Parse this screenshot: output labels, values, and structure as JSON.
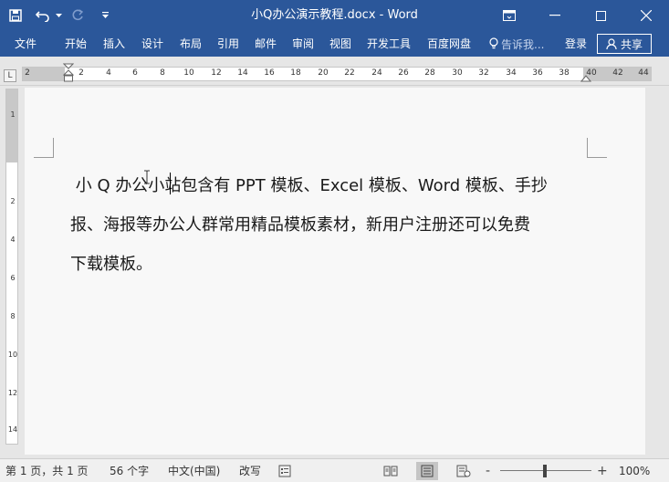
{
  "window": {
    "title": "小Q办公演示教程.docx - Word",
    "qat": {
      "save_icon": "save-icon",
      "undo_icon": "undo-icon",
      "redo_icon": "redo-icon",
      "customize_icon": "chevron-down-icon"
    },
    "controls": {
      "ribbon_display_icon": "ribbon-display-icon",
      "minimize_icon": "minimize-icon",
      "maximize_icon": "maximize-icon",
      "close_icon": "close-icon"
    }
  },
  "ribbon": {
    "tabs": [
      "文件",
      "开始",
      "插入",
      "设计",
      "布局",
      "引用",
      "邮件",
      "审阅",
      "视图",
      "开发工具",
      "百度网盘"
    ],
    "tell_me": "告诉我...",
    "login": "登录",
    "share": "共享"
  },
  "ruler": {
    "corner": "L",
    "h_labels": [
      "2",
      "2",
      "4",
      "6",
      "8",
      "10",
      "12",
      "14",
      "16",
      "18",
      "20",
      "22",
      "24",
      "26",
      "28",
      "30",
      "32",
      "34",
      "36",
      "38",
      "40",
      "42",
      "44"
    ],
    "v_labels": [
      "1",
      "2",
      "4",
      "6",
      "8",
      "10",
      "12",
      "14"
    ]
  },
  "document": {
    "lines": [
      " 小 Q 办公小站包含有 PPT 模板、Excel 模板、Word 模板、手抄",
      "报、海报等办公人群常用精品模板素材，新用户注册还可以免费",
      "下载模板。"
    ]
  },
  "status": {
    "page": "第 1 页，共 1 页",
    "words": "56 个字",
    "language": "中文(中国)",
    "mode": "改写",
    "macro_icon": "macro-record-icon",
    "zoom_minus": "-",
    "zoom_plus": "+",
    "zoom": "100%"
  },
  "colors": {
    "accent": "#2b579a",
    "status_bg": "#f0f0f0",
    "page_bg": "#f8f8f8"
  }
}
